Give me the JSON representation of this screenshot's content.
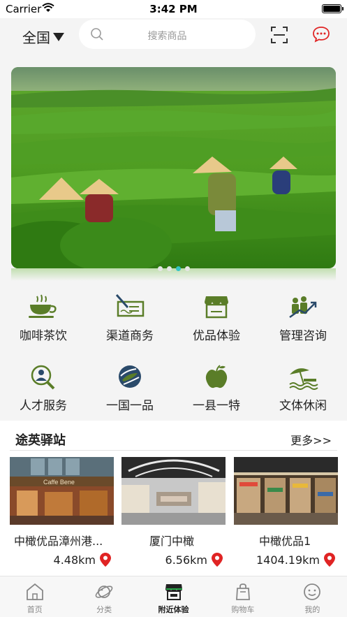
{
  "status_bar": {
    "carrier": "Carrier",
    "time": "3:42 PM"
  },
  "header": {
    "region": "全国",
    "search_placeholder": "搜索商品"
  },
  "banner": {
    "slide_count": 4,
    "active_slide": 3
  },
  "categories": [
    {
      "label": "咖啡茶饮",
      "icon": "coffee-cup-icon"
    },
    {
      "label": "渠道商务",
      "icon": "signature-card-icon"
    },
    {
      "label": "优品体验",
      "icon": "store-icon"
    },
    {
      "label": "管理咨询",
      "icon": "growth-chart-icon"
    },
    {
      "label": "人才服务",
      "icon": "talent-search-icon"
    },
    {
      "label": "一国一品",
      "icon": "globe-logo-icon"
    },
    {
      "label": "一县一特",
      "icon": "apple-icon"
    },
    {
      "label": "文体休闲",
      "icon": "leisure-icon"
    }
  ],
  "station": {
    "title": "途英驿站",
    "more": "更多>>",
    "cards": [
      {
        "name": "中橄优品漳州港...",
        "distance": "4.48km",
        "sign": "Caffe Bene"
      },
      {
        "name": "厦门中橄",
        "distance": "6.56km"
      },
      {
        "name": "中橄优品1",
        "distance": "1404.19km"
      }
    ]
  },
  "tabs": [
    {
      "label": "首页",
      "icon": "home-icon"
    },
    {
      "label": "分类",
      "icon": "planet-icon"
    },
    {
      "label": "附近体验",
      "icon": "nearby-store-icon",
      "active": true
    },
    {
      "label": "购物车",
      "icon": "shopping-bag-icon"
    },
    {
      "label": "我的",
      "icon": "smiley-icon"
    }
  ],
  "colors": {
    "accent_green": "#5a7d28",
    "message_red": "#e02424",
    "pin_red": "#e02424",
    "dot_active": "#35c5c5"
  }
}
